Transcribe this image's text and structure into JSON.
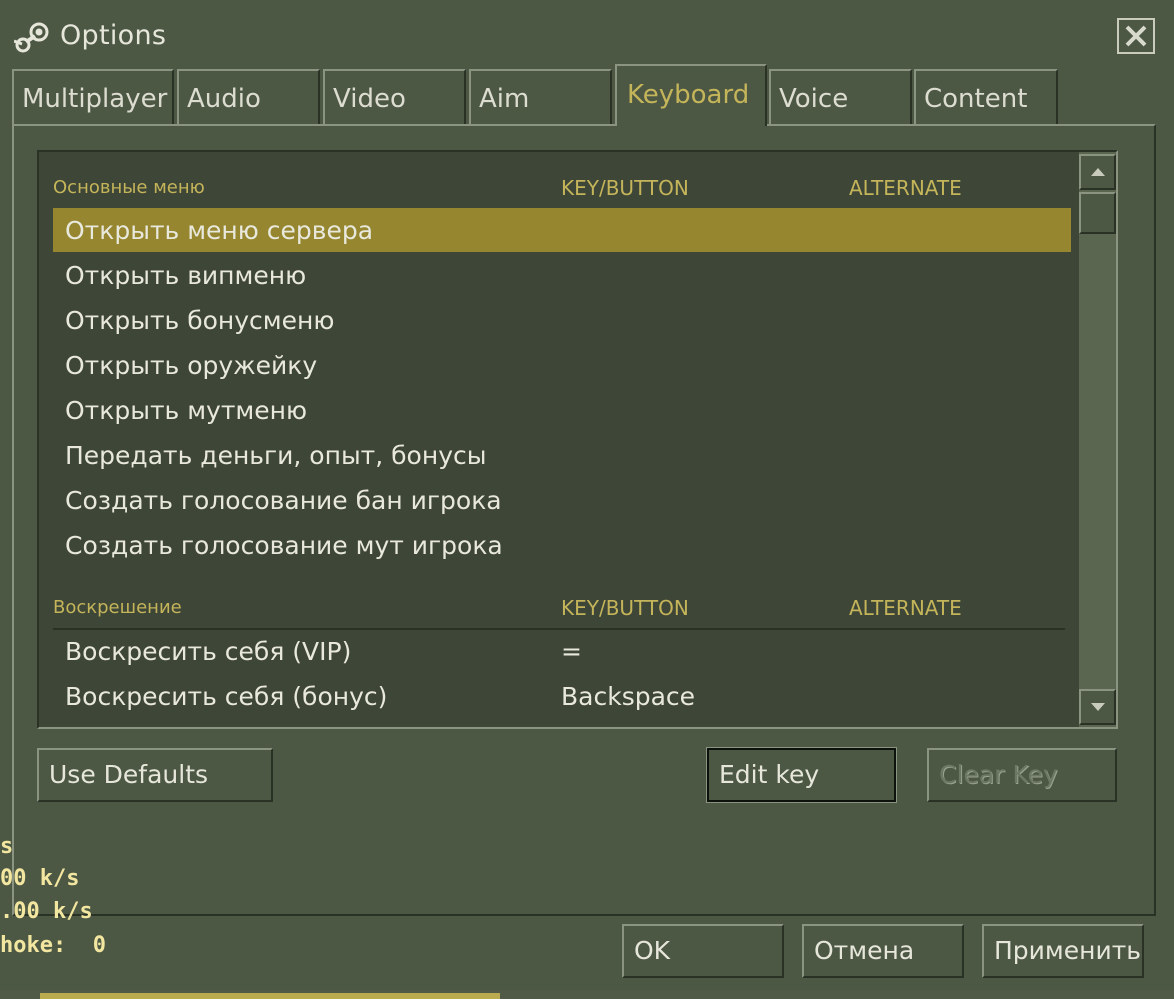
{
  "window": {
    "title": "Options",
    "close_label": "✕"
  },
  "tabs": [
    {
      "label": "Multiplayer",
      "active": false
    },
    {
      "label": "Audio",
      "active": false
    },
    {
      "label": "Video",
      "active": false
    },
    {
      "label": "Aim",
      "active": false
    },
    {
      "label": "Keyboard",
      "active": true
    },
    {
      "label": "Voice",
      "active": false
    },
    {
      "label": "Content",
      "active": false
    }
  ],
  "keyboard": {
    "sections": [
      {
        "title": "Основные меню",
        "key_header": "KEY/BUTTON",
        "alt_header": "ALTERNATE",
        "rows": [
          {
            "action": "Открыть меню сервера",
            "key": "",
            "alternate": "",
            "selected": true
          },
          {
            "action": "Открыть випменю",
            "key": "",
            "alternate": ""
          },
          {
            "action": "Открыть бонусменю",
            "key": "",
            "alternate": ""
          },
          {
            "action": "Открыть оружейку",
            "key": "",
            "alternate": ""
          },
          {
            "action": "Открыть мутменю",
            "key": "",
            "alternate": ""
          },
          {
            "action": "Передать деньги, опыт, бонусы",
            "key": "",
            "alternate": ""
          },
          {
            "action": "Создать голосование бан игрока",
            "key": "",
            "alternate": ""
          },
          {
            "action": "Создать голосование мут игрока",
            "key": "",
            "alternate": ""
          }
        ]
      },
      {
        "title": "Воскрешение",
        "key_header": "KEY/BUTTON",
        "alt_header": "ALTERNATE",
        "rows": [
          {
            "action": "Воскресить себя (VIP)",
            "key": "=",
            "alternate": ""
          },
          {
            "action": "Воскресить себя (бонус)",
            "key": "Backspace",
            "alternate": ""
          }
        ]
      }
    ],
    "buttons": {
      "use_defaults": "Use Defaults",
      "edit_key": "Edit key",
      "clear_key": "Clear Key"
    }
  },
  "footer": {
    "ok": "OK",
    "cancel": "Отмена",
    "apply": "Применить"
  },
  "hud": {
    "line1": "s",
    "line2": "00 k/s",
    "line3": ".00 k/s",
    "line4": "hoke:  0"
  },
  "colors": {
    "background": "#4c5844",
    "list_background": "#3e4637",
    "accent_text": "#c4b45a",
    "selection": "#968630"
  }
}
